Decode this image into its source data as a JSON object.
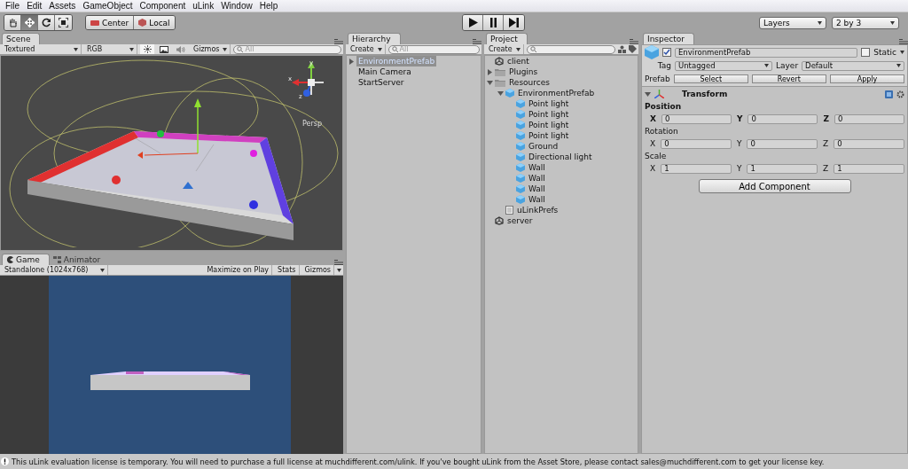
{
  "menu": [
    "File",
    "Edit",
    "Assets",
    "GameObject",
    "Component",
    "uLink",
    "Window",
    "Help"
  ],
  "toolbar": {
    "tools": [
      {
        "kind": "hand",
        "selected": false
      },
      {
        "kind": "move",
        "selected": true
      },
      {
        "kind": "rotate",
        "selected": false
      },
      {
        "kind": "scale",
        "selected": false
      }
    ],
    "pivot": [
      {
        "kind": "center",
        "label": "Center"
      },
      {
        "kind": "local",
        "label": "Local"
      }
    ],
    "play": [
      {
        "kind": "play",
        "on": false
      },
      {
        "kind": "pause",
        "on": false
      },
      {
        "kind": "step",
        "on": false
      }
    ],
    "layers": "Layers",
    "layout": "2 by 3"
  },
  "scene": {
    "tab": "Scene",
    "shading": "Textured",
    "render": "RGB",
    "toggles": [
      {
        "kind": "light",
        "on": true
      },
      {
        "kind": "image",
        "on": false
      },
      {
        "kind": "audio",
        "on": false
      }
    ],
    "gizmos": "Gizmos",
    "search_placeholder": "All",
    "axes": [
      "y",
      "x",
      "z"
    ],
    "projection": "Persp"
  },
  "game": {
    "tabs": [
      {
        "label": "Game",
        "kind": "game",
        "selected": true
      },
      {
        "label": "Animator",
        "kind": "animator",
        "selected": false
      }
    ],
    "aspect": "Standalone (1024x768)",
    "buttons": [
      "Maximize on Play",
      "Stats",
      "Gizmos"
    ]
  },
  "hierarchy": {
    "tab": "Hierarchy",
    "create": "Create",
    "search_placeholder": "All",
    "items": [
      {
        "label": "EnvironmentPrefab",
        "selected": true,
        "expanded": false
      },
      {
        "label": "Main Camera",
        "selected": false
      },
      {
        "label": "StartServer",
        "selected": false
      }
    ]
  },
  "project": {
    "tab": "Project",
    "create": "Create",
    "tree": [
      {
        "label": "client",
        "kind": "scene"
      },
      {
        "label": "Plugins",
        "kind": "folder",
        "expanded": false
      },
      {
        "label": "Resources",
        "kind": "folder",
        "expanded": true,
        "children": [
          {
            "label": "EnvironmentPrefab",
            "kind": "prefab",
            "expanded": true,
            "children": [
              {
                "label": "Point light",
                "kind": "prefab"
              },
              {
                "label": "Point light",
                "kind": "prefab"
              },
              {
                "label": "Point light",
                "kind": "prefab"
              },
              {
                "label": "Point light",
                "kind": "prefab"
              },
              {
                "label": "Ground",
                "kind": "prefab"
              },
              {
                "label": "Directional light",
                "kind": "prefab"
              },
              {
                "label": "Wall",
                "kind": "prefab"
              },
              {
                "label": "Wall",
                "kind": "prefab"
              },
              {
                "label": "Wall",
                "kind": "prefab"
              },
              {
                "label": "Wall",
                "kind": "prefab"
              }
            ]
          },
          {
            "label": "uLinkPrefs",
            "kind": "asset"
          }
        ]
      },
      {
        "label": "server",
        "kind": "scene"
      }
    ]
  },
  "inspector": {
    "tab": "Inspector",
    "name": "EnvironmentPrefab",
    "active": true,
    "static_label": "Static",
    "static": false,
    "tag_label": "Tag",
    "tag": "Untagged",
    "layer_label": "Layer",
    "layer": "Default",
    "prefab_label": "Prefab",
    "prefab_buttons": [
      "Select",
      "Revert",
      "Apply"
    ],
    "component": {
      "title": "Transform",
      "expanded": true,
      "properties": [
        {
          "label": "Position",
          "modified": true,
          "values": [
            {
              "axis": "X",
              "value": "0"
            },
            {
              "axis": "Y",
              "value": "0"
            },
            {
              "axis": "Z",
              "value": "0"
            }
          ]
        },
        {
          "label": "Rotation",
          "modified": false,
          "values": [
            {
              "axis": "X",
              "value": "0"
            },
            {
              "axis": "Y",
              "value": "0"
            },
            {
              "axis": "Z",
              "value": "0"
            }
          ]
        },
        {
          "label": "Scale",
          "modified": false,
          "values": [
            {
              "axis": "X",
              "value": "1"
            },
            {
              "axis": "Y",
              "value": "1"
            },
            {
              "axis": "Z",
              "value": "1"
            }
          ]
        }
      ]
    },
    "add_component": "Add Component"
  },
  "status": "This uLink evaluation license is temporary. You will need to purchase a full license at muchdifferent.com/ulink. If you've bought uLink from the Asset Store, please contact sales@muchdifferent.com to get your license key."
}
